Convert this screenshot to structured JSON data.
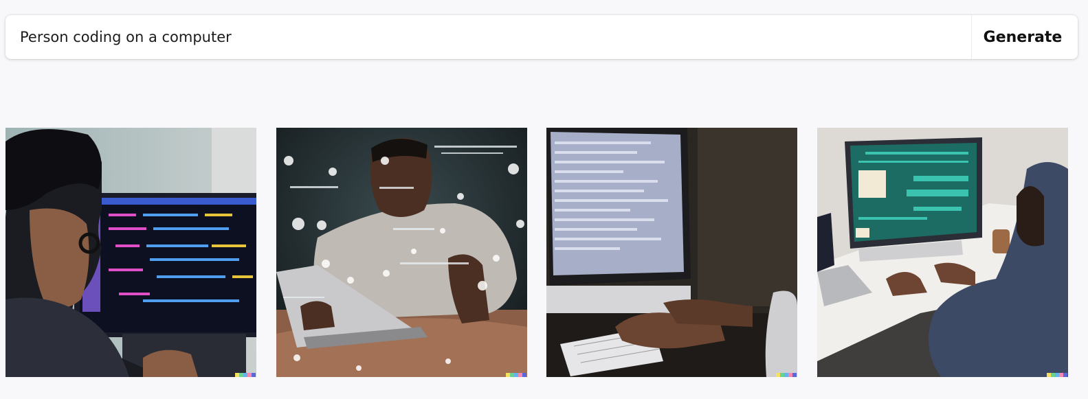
{
  "prompt": {
    "value": "Person coding on a computer"
  },
  "generate_button": {
    "label": "Generate"
  },
  "results": [
    {
      "subject": "man with glasses viewing code on monitor"
    },
    {
      "subject": "man typing on laptop with floating code and lights"
    },
    {
      "subject": "hands typing on keyboard in front of monitor"
    },
    {
      "subject": "person in hoodie typing at desk with monitor and laptop"
    }
  ],
  "watermark_colors": [
    "#f6e05e",
    "#68d391",
    "#63b3ed",
    "#f687b3",
    "#5a67d8"
  ]
}
